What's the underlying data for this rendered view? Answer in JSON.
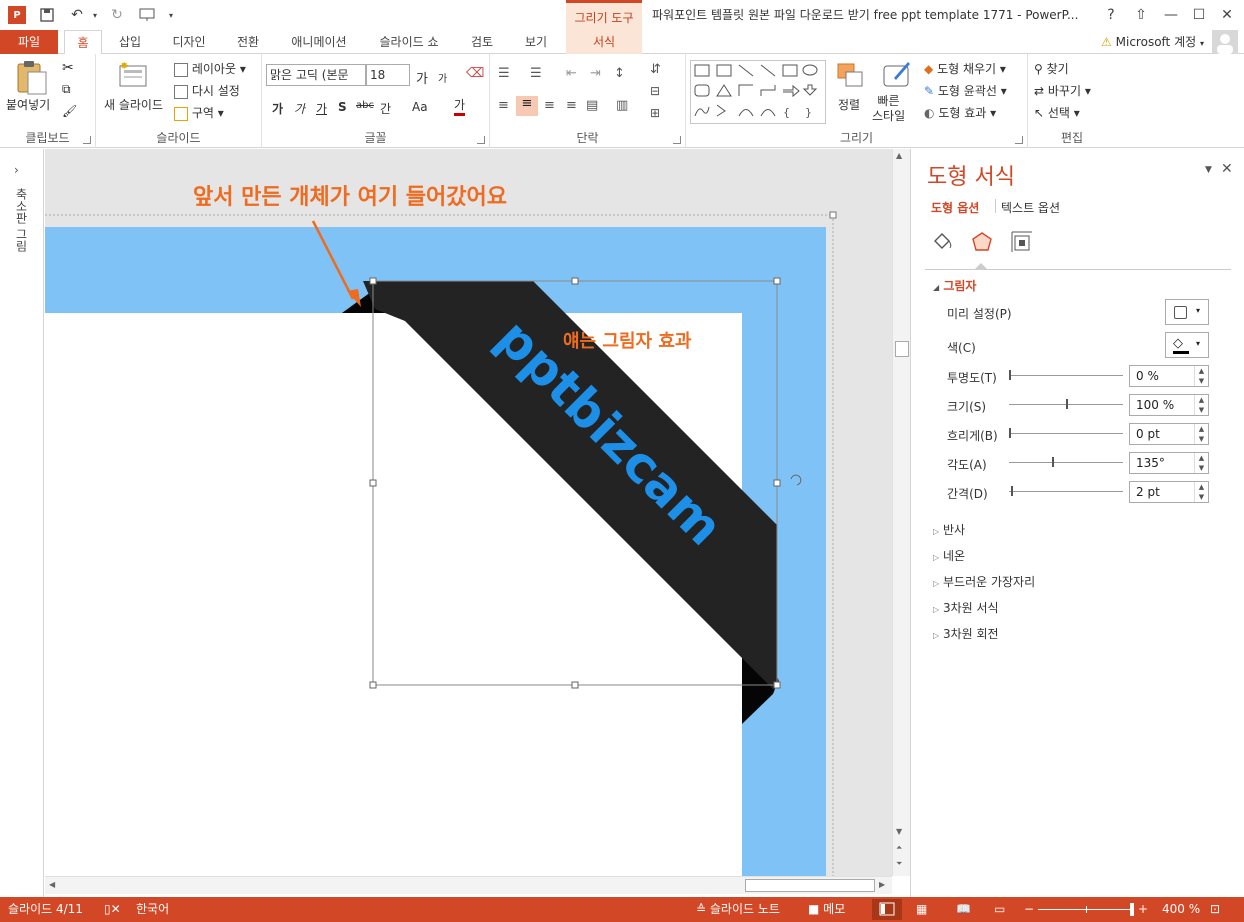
{
  "window": {
    "title": "파워포인트 템플릿 원본 파일 다운로드 받기 free ppt template 1771 - PowerP...",
    "context_tab_group": "그리기 도구",
    "help": "?",
    "restore_ribbon": "⇧",
    "minimize": "—",
    "maximize": "☐",
    "close": "✕"
  },
  "tabs": {
    "file": "파일",
    "home": "홈",
    "insert": "삽입",
    "design": "디자인",
    "transitions": "전환",
    "animations": "애니메이션",
    "slideshow": "슬라이드 쇼",
    "review": "검토",
    "view": "보기",
    "format": "서식"
  },
  "account": {
    "label": "Microsoft 계정"
  },
  "ribbon": {
    "clipboard": {
      "label": "클립보드",
      "paste": "붙여넣기"
    },
    "slides": {
      "label": "슬라이드",
      "new_slide": "새 슬라이드",
      "layout": "레이아웃",
      "reset": "다시 설정",
      "section": "구역"
    },
    "font": {
      "label": "글꼴",
      "font_name": "맑은 고딕 (본문",
      "font_size": "18",
      "grow": "가",
      "shrink": "가",
      "bold": "가",
      "italic": "가",
      "underline": "가",
      "shadow": "S",
      "strike": "abc",
      "spacing": "간",
      "case": "Aa",
      "color": "가"
    },
    "paragraph": {
      "label": "단락"
    },
    "drawing": {
      "label": "그리기",
      "arrange": "정렬",
      "quick_styles": "빠른\n스타일",
      "fill": "도형 채우기",
      "outline": "도형 윤곽선",
      "effects": "도형 효과"
    },
    "editing": {
      "label": "편집",
      "find": "찾기",
      "replace": "바꾸기",
      "select": "선택"
    }
  },
  "thumb_strip": {
    "label": "축소판 그림"
  },
  "slide": {
    "annotation_top": "앞서 만든 개체가 여기 들어갔어요",
    "annotation_shadow": "얘는 그림자 효과",
    "ribbon_text": "pptbizcam",
    "colors": {
      "blue": "#7fc2f5",
      "ribbon": "#222222",
      "annotation": "#ef6b1f",
      "ribbon_text": "#1e8fe6"
    }
  },
  "pane": {
    "title": "도형 서식",
    "tab_shape": "도형 옵션",
    "tab_text": "텍스트 옵션",
    "section_shadow": "그림자",
    "rows": {
      "preset": "미리 설정(P)",
      "color": "색(C)",
      "transparency": "투명도(T)",
      "size": "크기(S)",
      "blur": "흐리게(B)",
      "angle": "각도(A)",
      "distance": "간격(D)"
    },
    "values": {
      "transparency": "0 %",
      "size": "100 %",
      "blur": "0 pt",
      "angle": "135°",
      "distance": "2 pt"
    },
    "slider_levels": {
      "transparency": 0,
      "size": 0.5,
      "blur": 0,
      "angle": 0.375,
      "distance": 0.02
    },
    "sections": [
      "반사",
      "네온",
      "부드러운 가장자리",
      "3차원 서식",
      "3차원 회전"
    ]
  },
  "status": {
    "slide": "슬라이드 4/11",
    "language": "한국어",
    "notes": "슬라이드 노트",
    "comments": "메모",
    "zoom": "400 %"
  }
}
